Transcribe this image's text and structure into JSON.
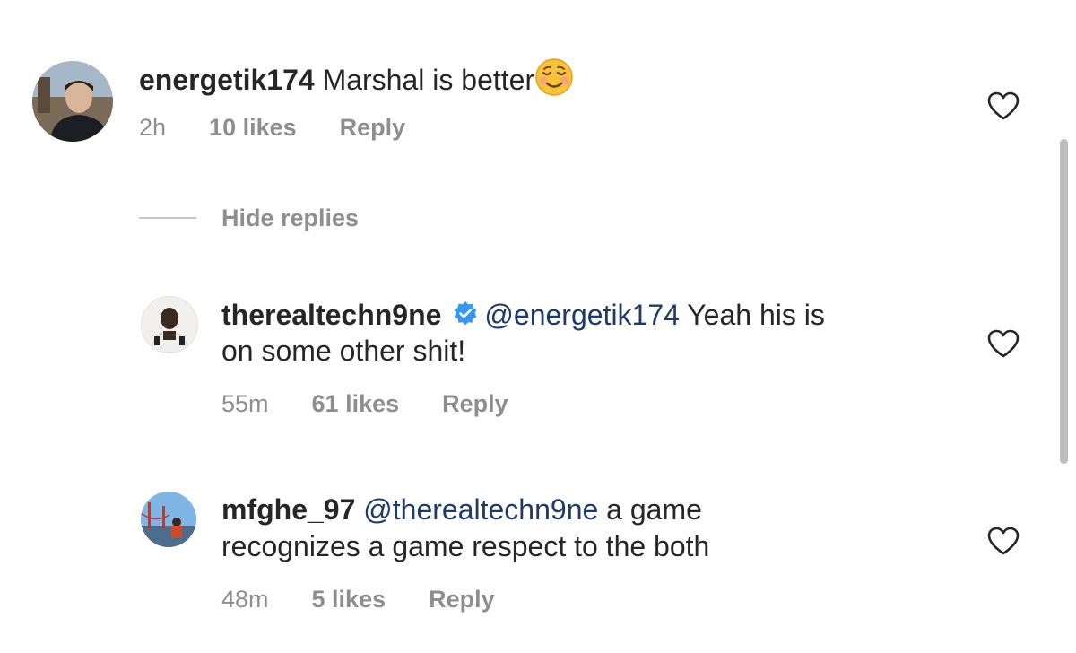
{
  "comments": [
    {
      "username": "energetik174",
      "mention": "",
      "text_line1": "Marshal is better",
      "text_line2": "",
      "emoji": "relieved-smiling-face",
      "time": "2h",
      "likes": "10 likes",
      "reply": "Reply"
    },
    {
      "username": "therealtechn9ne",
      "verified": true,
      "mention": "@energetik174",
      "text_line1": "Yeah his is",
      "text_line2": "on some other shit!",
      "time": "55m",
      "likes": "61 likes",
      "reply": "Reply"
    },
    {
      "username": "mfghe_97",
      "mention": "@therealtechn9ne",
      "text_line1": "a game",
      "text_line2": "recognizes a game respect to the both",
      "time": "48m",
      "likes": "5 likes",
      "reply": "Reply"
    }
  ],
  "thread": {
    "hide_replies": "Hide replies"
  },
  "colors": {
    "text": "#262626",
    "muted": "#8e8e8e",
    "mention": "#1f3a66",
    "verified": "#3897f0"
  },
  "icons": {
    "like": "heart-outline-icon",
    "verified": "verified-badge-icon"
  }
}
